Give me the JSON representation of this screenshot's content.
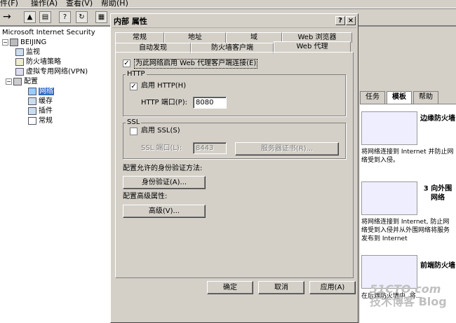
{
  "menubar": {
    "items": [
      "件(F)",
      "操作(A)",
      "查看(V)",
      "帮助(H)"
    ]
  },
  "tree": {
    "root": "Microsoft Internet Security",
    "server": "BEIJING",
    "items": [
      "监视",
      "防火墙策略",
      "虚拟专用网络(VPN)",
      "配置"
    ],
    "config_children": [
      "网络",
      "缓存",
      "插件",
      "常规"
    ]
  },
  "right_pane": {
    "tabs": [
      "任务",
      "模板",
      "帮助"
    ],
    "cards": [
      {
        "title": "边缘防火墙",
        "desc": "将网络连接到 Internet 并防止网络受到入侵。"
      },
      {
        "title": "3 向外围网络",
        "desc": "将网络连接到 Internet, 防止网络受到入侵并从外围网络将服务发布到 Internet"
      },
      {
        "title": "前端防火墙",
        "desc": "在后端防火墙中, 将..."
      }
    ]
  },
  "dialog": {
    "title": "内部 属性",
    "help_btn": "?",
    "close_btn": "×",
    "tabs_row1": [
      "常规",
      "地址",
      "域",
      "Web 浏览器"
    ],
    "tabs_row2": [
      "自动发现",
      "防火墙客户端",
      "Web 代理"
    ],
    "enable_proxy": "为此网络启用 Web 代理客户端连接(E)",
    "http_group": "HTTP",
    "enable_http": "启用 HTTP(H)",
    "http_port_label": "HTTP 端口(P):",
    "http_port_value": "8080",
    "ssl_group": "SSL",
    "enable_ssl": "启用 SSL(S)",
    "ssl_port_label": "SSL 端口(L):",
    "ssl_port_value": "8443",
    "server_cert_btn": "服务器证书(R)...",
    "auth_label": "配置允许的身份验证方法:",
    "auth_btn": "身份验证(A)...",
    "advanced_label": "配置高级属性:",
    "advanced_btn": "高级(V)...",
    "ok": "确定",
    "cancel": "取消",
    "apply": "应用(A)"
  },
  "watermark": {
    "line1": "51CTO.com",
    "line2": "技术博客 Blog"
  }
}
